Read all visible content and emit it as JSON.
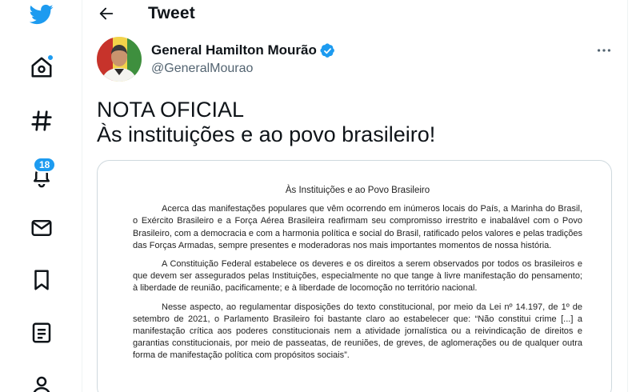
{
  "header": {
    "title": "Tweet"
  },
  "sidebar": {
    "notifications_badge": "18"
  },
  "author": {
    "display_name": "General Hamilton Mourão",
    "handle": "@GeneralMourao"
  },
  "tweet": {
    "line1": "NOTA OFICIAL",
    "line2": "Às instituições e ao povo brasileiro!"
  },
  "document": {
    "title": "Às Instituições e ao Povo Brasileiro",
    "paragraphs": [
      "Acerca das manifestações populares que vêm ocorrendo em inúmeros locais do País, a Marinha do Brasil, o Exército Brasileiro e a Força Aérea Brasileira reafirmam seu compromisso irrestrito e inabalável com o Povo Brasileiro, com a democracia e com a harmonia política e social do Brasil, ratificado pelos valores e pelas tradições das Forças Armadas, sempre presentes e moderadoras nos mais importantes momentos de nossa história.",
      "A Constituição Federal estabelece os deveres e os direitos a serem observados por todos os brasileiros e que devem ser assegurados pelas Instituições, especialmente no que tange à livre manifestação do pensamento; à liberdade de reunião, pacificamente; e à liberdade de locomoção no território nacional.",
      "Nesse aspecto, ao regulamentar disposições do texto constitucional, por meio da Lei nº 14.197, de 1º de setembro de 2021, o Parlamento Brasileiro foi bastante claro ao estabelecer que: “Não constitui crime [...] a manifestação crítica aos poderes constitucionais nem a atividade jornalística ou a reivindicação de direitos e garantias constitucionais, por meio de passeatas, de reuniões, de greves, de aglomerações ou de qualquer outra forma de manifestação política com propósitos sociais”."
    ]
  },
  "colors": {
    "accent": "#1d9bf0",
    "text": "#0f1419",
    "muted": "#536471",
    "border": "#cfd9de"
  }
}
